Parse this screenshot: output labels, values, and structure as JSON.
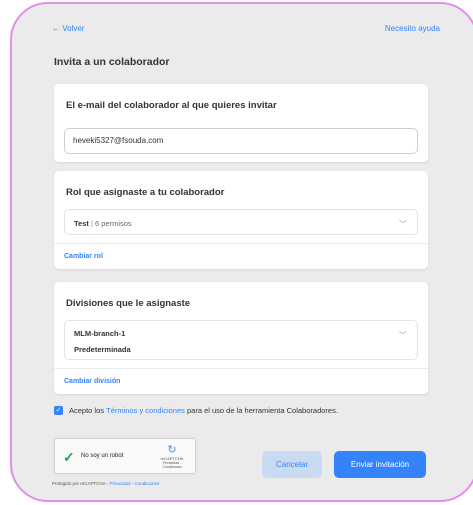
{
  "nav": {
    "back_label": "← Volver",
    "help_label": "Necesito ayuda"
  },
  "page": {
    "title": "Invita a un colaborador"
  },
  "email_card": {
    "title": "El e-mail del colaborador al que quieres invitar",
    "value": "heveki5327@fsouda.com"
  },
  "role_card": {
    "title": "Rol que asignaste a tu colaborador",
    "role_name": "Test",
    "role_separator": " | ",
    "role_permissions": "6 permisos",
    "change_label": "Cambiar rol"
  },
  "divisions_card": {
    "title": "Divisiones que le asignaste",
    "items": [
      "MLM-branch-1",
      "Predeterminada"
    ],
    "change_label": "Cambiar división"
  },
  "terms": {
    "prefix": "Acepto los ",
    "link": "Términos y condiciones",
    "suffix": " para el uso de la herramienta Colaboradores.",
    "checked": true
  },
  "captcha": {
    "label": "No soy un robot",
    "brand": "reCAPTCHA",
    "links": "Privacidad - Condiciones"
  },
  "footer": {
    "protected_prefix": "Protegido por reCAPTCHA - ",
    "privacy": "Privacidad",
    "sep": " - ",
    "terms": "Condiciones"
  },
  "actions": {
    "cancel_label": "Cancelar",
    "submit_label": "Enviar invitación"
  },
  "colors": {
    "accent": "#3483fa",
    "frame_border": "#e08fe8",
    "background": "#ebebeb"
  }
}
